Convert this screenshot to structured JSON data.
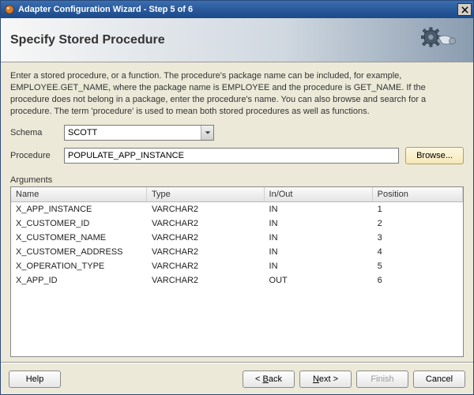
{
  "window": {
    "title": "Adapter Configuration Wizard - Step 5 of 6"
  },
  "header": {
    "heading": "Specify Stored Procedure"
  },
  "instruction": "Enter a stored procedure, or a function. The procedure's package name can be included, for example, EMPLOYEE.GET_NAME, where the package name is EMPLOYEE and the procedure is GET_NAME.  If the procedure does not belong in a package, enter the procedure's name. You can also browse and search for a procedure. The term 'procedure' is used to mean both stored procedures as well as functions.",
  "form": {
    "schema_label": "Schema",
    "schema_value": "SCOTT",
    "procedure_label": "Procedure",
    "procedure_value": "POPULATE_APP_INSTANCE",
    "browse_label": "Browse..."
  },
  "arguments": {
    "section_label": "Arguments",
    "columns": {
      "name": "Name",
      "type": "Type",
      "inout": "In/Out",
      "position": "Position"
    },
    "rows": [
      {
        "name": "X_APP_INSTANCE",
        "type": "VARCHAR2",
        "inout": "IN",
        "position": "1"
      },
      {
        "name": "X_CUSTOMER_ID",
        "type": "VARCHAR2",
        "inout": "IN",
        "position": "2"
      },
      {
        "name": "X_CUSTOMER_NAME",
        "type": "VARCHAR2",
        "inout": "IN",
        "position": "3"
      },
      {
        "name": "X_CUSTOMER_ADDRESS",
        "type": "VARCHAR2",
        "inout": "IN",
        "position": "4"
      },
      {
        "name": "X_OPERATION_TYPE",
        "type": "VARCHAR2",
        "inout": "IN",
        "position": "5"
      },
      {
        "name": "X_APP_ID",
        "type": "VARCHAR2",
        "inout": "OUT",
        "position": "6"
      }
    ]
  },
  "footer": {
    "help": "Help",
    "back": "Back",
    "next": "Next",
    "finish": "Finish",
    "cancel": "Cancel"
  }
}
